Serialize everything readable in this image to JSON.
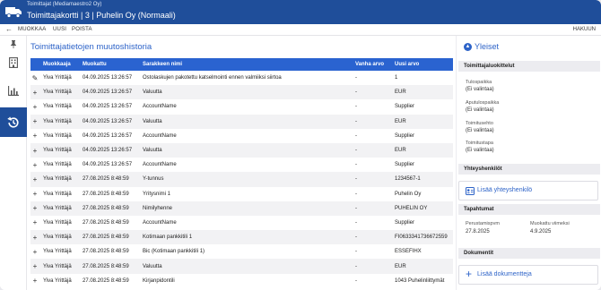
{
  "header": {
    "subtitle": "Toimittajat (Mediamaestro2 Oy)",
    "title": "Toimittajakortti | 3 | Puhelin Oy (Normaali)"
  },
  "toolbar": {
    "edit_label": "MUOKKAA",
    "new_label": "UUSI",
    "delete_label": "POISTA",
    "search_label": "HAKUUN"
  },
  "main": {
    "title": "Toimittajatietojen muutoshistoria",
    "columns": [
      "Muokkaaja",
      "Muokattu",
      "Sarakkeen nimi",
      "Vanha arvo",
      "Uusi arvo"
    ],
    "rows": [
      {
        "icon": "edit",
        "user": "Yiva Yrittäjä",
        "date": "04.09.2025 13:26:57",
        "field": "Ostolaskujen pakotettu katselmointi ennen valmiiksi siirtoa",
        "old": "-",
        "new": "1"
      },
      {
        "icon": "plus",
        "user": "Yiva Yrittäjä",
        "date": "04.09.2025 13:26:57",
        "field": "Valuutta",
        "old": "-",
        "new": "EUR"
      },
      {
        "icon": "plus",
        "user": "Yiva Yrittäjä",
        "date": "04.09.2025 13:26:57",
        "field": "AccountName",
        "old": "-",
        "new": "Supplier"
      },
      {
        "icon": "plus",
        "user": "Yiva Yrittäjä",
        "date": "04.09.2025 13:26:57",
        "field": "Valuutta",
        "old": "-",
        "new": "EUR"
      },
      {
        "icon": "plus",
        "user": "Yiva Yrittäjä",
        "date": "04.09.2025 13:26:57",
        "field": "AccountName",
        "old": "-",
        "new": "Supplier"
      },
      {
        "icon": "plus",
        "user": "Yiva Yrittäjä",
        "date": "04.09.2025 13:26:57",
        "field": "Valuutta",
        "old": "-",
        "new": "EUR"
      },
      {
        "icon": "plus",
        "user": "Yiva Yrittäjä",
        "date": "04.09.2025 13:26:57",
        "field": "AccountName",
        "old": "-",
        "new": "Supplier"
      },
      {
        "icon": "plus",
        "user": "Yiva Yrittäjä",
        "date": "27.08.2025 8:48:59",
        "field": "Y-tunnus",
        "old": "-",
        "new": "1234567-1"
      },
      {
        "icon": "plus",
        "user": "Yiva Yrittäjä",
        "date": "27.08.2025 8:48:59",
        "field": "Yritysnimi 1",
        "old": "-",
        "new": "Puhelin Oy"
      },
      {
        "icon": "plus",
        "user": "Yiva Yrittäjä",
        "date": "27.08.2025 8:48:59",
        "field": "Nimilyhenne",
        "old": "-",
        "new": "PUHELIN OY"
      },
      {
        "icon": "plus",
        "user": "Yiva Yrittäjä",
        "date": "27.08.2025 8:48:59",
        "field": "AccountName",
        "old": "-",
        "new": "Supplier"
      },
      {
        "icon": "plus",
        "user": "Yiva Yrittäjä",
        "date": "27.08.2025 8:48:59",
        "field": "Kotimaan pankkitili 1",
        "old": "-",
        "new": "FI0633341736672559"
      },
      {
        "icon": "plus",
        "user": "Yiva Yrittäjä",
        "date": "27.08.2025 8:48:59",
        "field": "Bic (Kotimaan pankkitili 1)",
        "old": "-",
        "new": "ESSEFIHX"
      },
      {
        "icon": "plus",
        "user": "Yiva Yrittäjä",
        "date": "27.08.2025 8:48:59",
        "field": "Valuutta",
        "old": "-",
        "new": "EUR"
      },
      {
        "icon": "plus",
        "user": "Yiva Yrittäjä",
        "date": "27.08.2025 8:48:59",
        "field": "Kirjanpidontili",
        "old": "-",
        "new": "1043 Puhelinliittymät"
      }
    ]
  },
  "side": {
    "title": "Yleiset",
    "class_section": "Toimittajaluokittelut",
    "class_fields": [
      {
        "label": "Tulospaikka",
        "value": "(Ei valintaa)"
      },
      {
        "label": "Aputulospaikka",
        "value": "(Ei valintaa)"
      },
      {
        "label": "Toimitusehto",
        "value": "(Ei valintaa)"
      },
      {
        "label": "Toimitustapa",
        "value": "(Ei valintaa)"
      }
    ],
    "contacts_section": "Yhteyshenkilöt",
    "add_contact": "Lisää yhteyshenkilö",
    "events_section": "Tapahtumat",
    "created_label": "Perustamispvm",
    "created_value": "27.8.2025",
    "modified_label": "Muokattu viimeksi",
    "modified_value": "4.9.2025",
    "documents_section": "Dokumentit",
    "add_document": "Lisää dokumentteja"
  },
  "colors": {
    "brand": "#1f4e9a",
    "accent": "#2a63d0",
    "link": "#2d63c8"
  }
}
